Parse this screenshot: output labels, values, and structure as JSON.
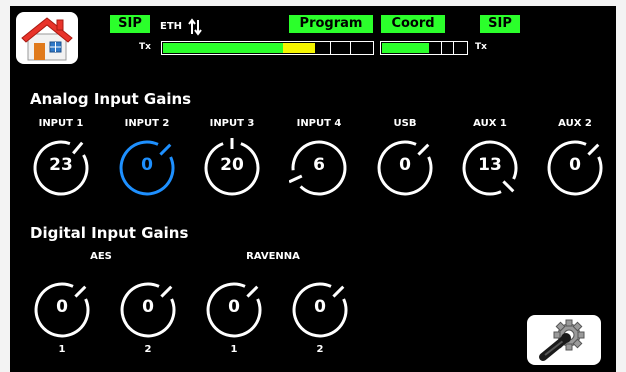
{
  "header": {
    "home_icon": "house-icon",
    "sip_left": "SIP",
    "eth_label": "ETH",
    "eth_icon": "up-down-arrows-icon",
    "tx_left": "Tx",
    "program": "Program",
    "coord": "Coord",
    "sip_right": "SIP",
    "tx_right": "Tx",
    "colors": {
      "badge": "#2bff2b",
      "meter_green": "#2bff2b",
      "meter_yellow": "#f5f500"
    },
    "meter_left": {
      "green_level": 0.57,
      "yellow_level": 0.72
    },
    "meter_right": {
      "green_level": 0.55
    }
  },
  "analog": {
    "title": "Analog Input Gains",
    "inputs": [
      {
        "label": "INPUT 1",
        "value": "23",
        "selected": false
      },
      {
        "label": "INPUT 2",
        "value": "0",
        "selected": true
      },
      {
        "label": "INPUT 3",
        "value": "20",
        "selected": false
      },
      {
        "label": "INPUT 4",
        "value": "6",
        "selected": false
      },
      {
        "label": "USB",
        "value": "0",
        "selected": false
      },
      {
        "label": "AUX 1",
        "value": "13",
        "selected": false
      },
      {
        "label": "AUX 2",
        "value": "0",
        "selected": false
      }
    ]
  },
  "digital": {
    "title": "Digital Input Gains",
    "groups": [
      {
        "label": "AES",
        "inputs": [
          {
            "num": "1",
            "value": "0"
          },
          {
            "num": "2",
            "value": "0"
          }
        ]
      },
      {
        "label": "RAVENNA",
        "inputs": [
          {
            "num": "1",
            "value": "0"
          },
          {
            "num": "2",
            "value": "0"
          }
        ]
      }
    ]
  },
  "settings_icon": "wrench-gear-icon",
  "colors": {
    "selected": "#1e90ff",
    "ring": "#ffffff",
    "background": "#000000"
  }
}
